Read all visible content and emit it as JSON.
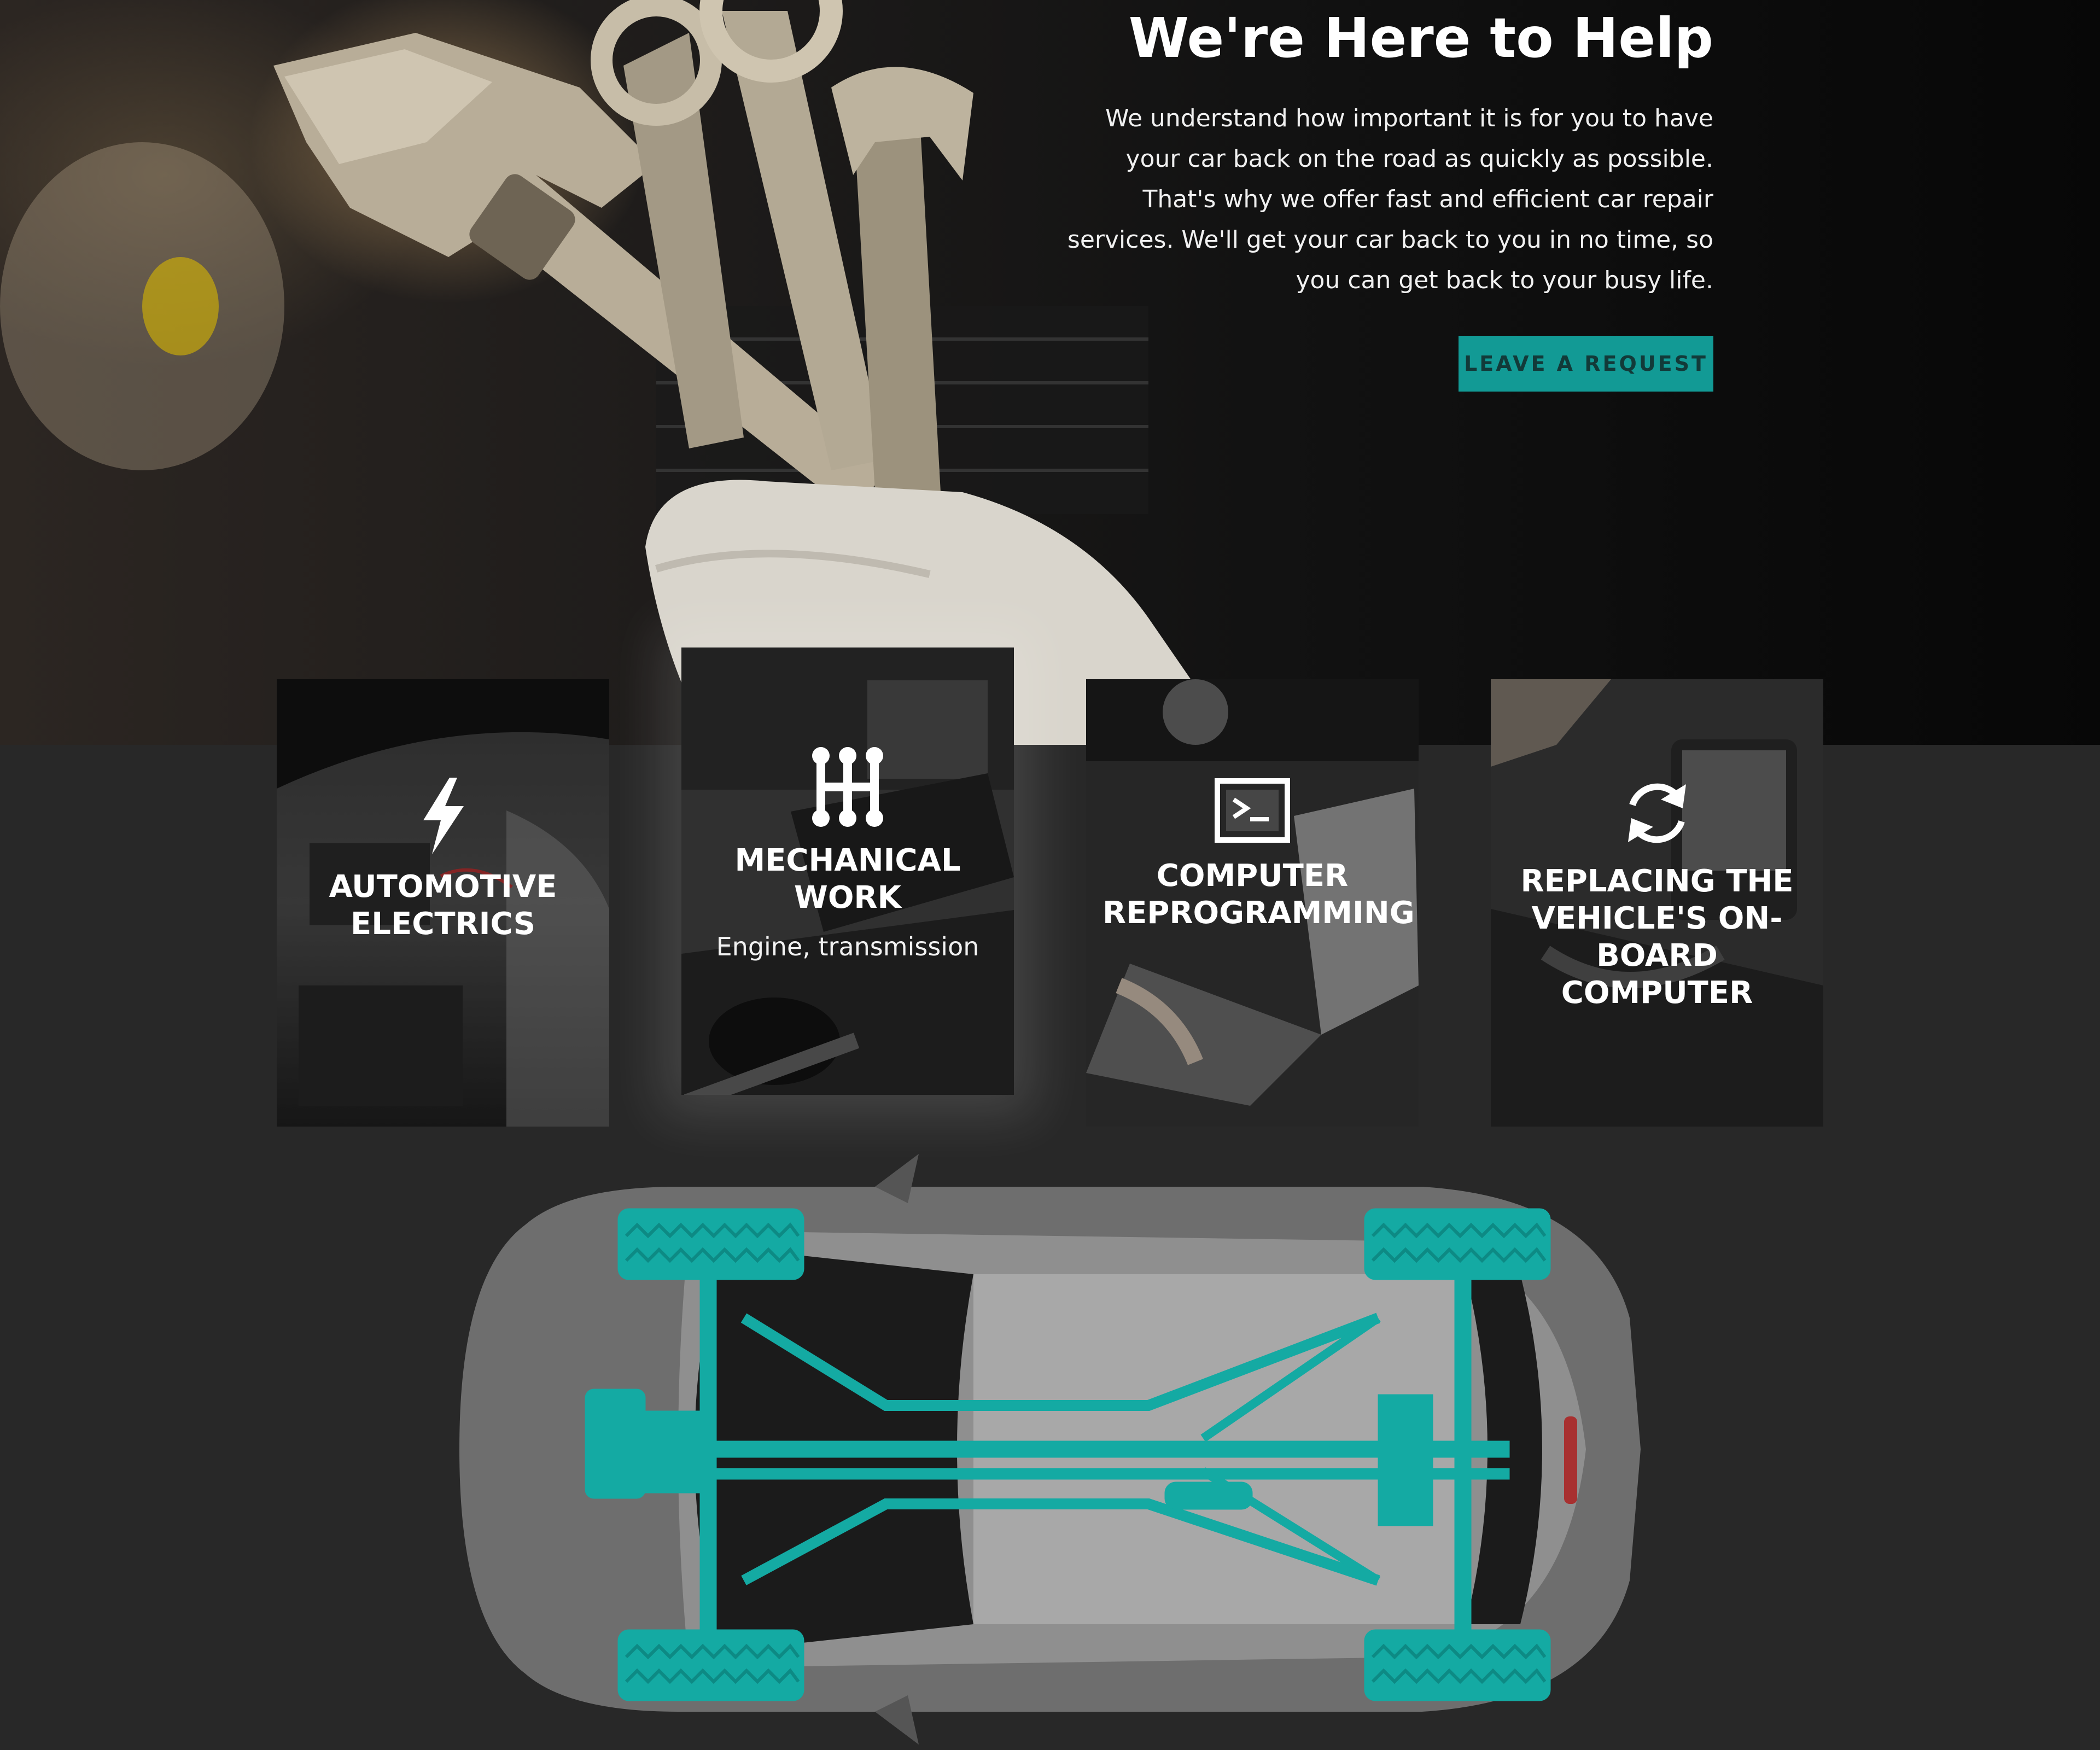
{
  "hero": {
    "title": "We're Here to Help",
    "description": "We understand how important it is for you to have your car back on the road as quickly as possible. That's why we offer fast and efficient car repair services. We'll get your car back to you in no time, so you can get back to your busy life.",
    "button_label": "LEAVE A REQUEST"
  },
  "services": [
    {
      "title": "AUTOMOTIVE ELECTRICS",
      "subtitle": "",
      "icon": "lightning-icon"
    },
    {
      "title": "MECHANICAL WORK",
      "subtitle": "Engine, transmission",
      "icon": "gear-shift-icon"
    },
    {
      "title": "COMPUTER REPROGRAMMING",
      "subtitle": "",
      "icon": "terminal-icon"
    },
    {
      "title": "REPLACING THE VEHICLE'S ON-BOARD COMPUTER",
      "subtitle": "",
      "icon": "refresh-icon"
    }
  ],
  "colors": {
    "accent": "#129a95",
    "dark_background": "#282828",
    "button_text": "#123a39"
  }
}
